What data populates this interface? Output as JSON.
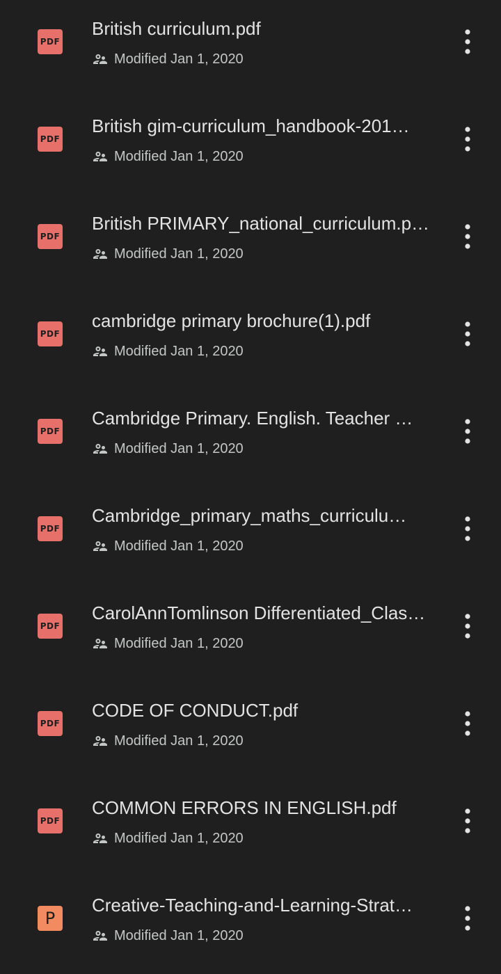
{
  "files": [
    {
      "title": "British curriculum.pdf",
      "type": "pdf",
      "icon_label": "PDF",
      "modified": "Modified Jan 1, 2020",
      "shared": true
    },
    {
      "title": "British gim-curriculum_handbook-201…",
      "type": "pdf",
      "icon_label": "PDF",
      "modified": "Modified Jan 1, 2020",
      "shared": true
    },
    {
      "title": "British PRIMARY_national_curriculum.p…",
      "type": "pdf",
      "icon_label": "PDF",
      "modified": "Modified Jan 1, 2020",
      "shared": true
    },
    {
      "title": "cambridge primary brochure(1).pdf",
      "type": "pdf",
      "icon_label": "PDF",
      "modified": "Modified Jan 1, 2020",
      "shared": true
    },
    {
      "title": "Cambridge Primary. English. Teacher …",
      "type": "pdf",
      "icon_label": "PDF",
      "modified": "Modified Jan 1, 2020",
      "shared": true
    },
    {
      "title": "Cambridge_primary_maths_curriculu…",
      "type": "pdf",
      "icon_label": "PDF",
      "modified": "Modified Jan 1, 2020",
      "shared": true
    },
    {
      "title": "CarolAnnTomlinson Differentiated_Clas…",
      "type": "pdf",
      "icon_label": "PDF",
      "modified": "Modified Jan 1, 2020",
      "shared": true
    },
    {
      "title": "CODE OF CONDUCT.pdf",
      "type": "pdf",
      "icon_label": "PDF",
      "modified": "Modified Jan 1, 2020",
      "shared": true
    },
    {
      "title": "COMMON ERRORS IN ENGLISH.pdf",
      "type": "pdf",
      "icon_label": "PDF",
      "modified": "Modified Jan 1, 2020",
      "shared": true
    },
    {
      "title": "Creative-Teaching-and-Learning-Strat…",
      "type": "ppt",
      "icon_label": "P",
      "modified": "Modified Jan 1, 2020",
      "shared": true
    }
  ],
  "icons": {
    "file_pdf": "pdf-file-icon",
    "file_ppt": "presentation-file-icon",
    "shared": "shared-people-icon",
    "more": "more-vert-icon"
  },
  "colors": {
    "background": "#1f1f1f",
    "pdf_icon": "#e8706a",
    "ppt_icon": "#f28b60",
    "title_text": "#e3e3e3",
    "meta_text": "#c4c7c5"
  }
}
